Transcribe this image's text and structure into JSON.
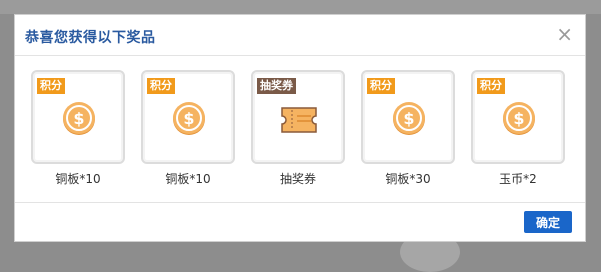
{
  "dialog": {
    "title": "恭喜您获得以下奖品",
    "close_glyph": "×",
    "confirm_label": "确定"
  },
  "colors": {
    "badge_points": "#f19a1b",
    "badge_lottery": "#7a5a48",
    "coin": "#f5b361",
    "button": "#1a66c9",
    "title": "#2a5aa0"
  },
  "rewards": [
    {
      "badge": "积分",
      "badge_type": "points",
      "icon": "coin-icon",
      "label": "铜板*10"
    },
    {
      "badge": "积分",
      "badge_type": "points",
      "icon": "coin-icon",
      "label": "铜板*10"
    },
    {
      "badge": "抽奖券",
      "badge_type": "lottery",
      "icon": "ticket-icon",
      "label": "抽奖券"
    },
    {
      "badge": "积分",
      "badge_type": "points",
      "icon": "coin-icon",
      "label": "铜板*30"
    },
    {
      "badge": "积分",
      "badge_type": "points",
      "icon": "coin-icon",
      "label": "玉币*2"
    }
  ]
}
